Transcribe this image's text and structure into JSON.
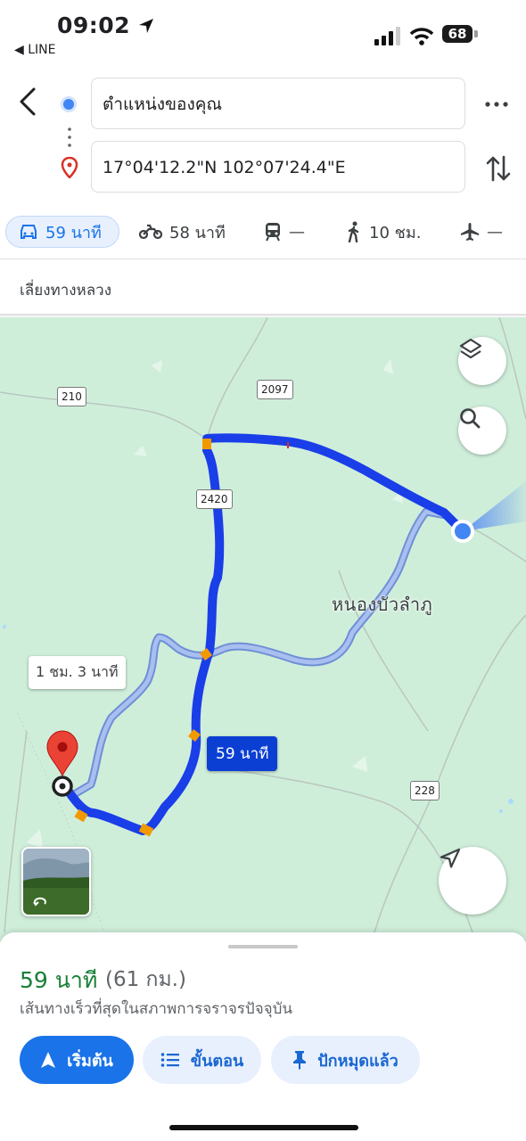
{
  "status_bar": {
    "time": "09:02",
    "back_app": "◀ LINE",
    "battery": "68"
  },
  "header": {
    "origin": "ตำแหน่งของคุณ",
    "destination": "17°04'12.2\"N 102°07'24.4\"E"
  },
  "modes": [
    {
      "name": "car",
      "label": "59 นาที",
      "active": true
    },
    {
      "name": "motorcycle",
      "label": "58 นาที",
      "active": false
    },
    {
      "name": "transit",
      "label": "—",
      "active": false
    },
    {
      "name": "walk",
      "label": "10 ชม.",
      "active": false
    },
    {
      "name": "flight",
      "label": "—",
      "active": false
    }
  ],
  "avoid_label": "เลี่ยงทางหลวง",
  "map": {
    "town_label": "หนองบัวลำภู",
    "road_shields": [
      "210",
      "2097",
      "2420",
      "228"
    ],
    "alt_route_callout": "1 ชม. 3 นาที",
    "main_route_callout": "59 นาที",
    "route_color": "#1a3ee8",
    "alt_route_color": "#a8bff0",
    "map_bg_color": "#cfeeda",
    "destination_pin_color": "#ea4335"
  },
  "sheet": {
    "duration": "59 นาที",
    "distance": "(61 กม.)",
    "description": "เส้นทางเร็วที่สุดในสภาพการจราจรปัจจุบัน",
    "start_label": "เริ่มต้น",
    "steps_label": "ขั้นตอน",
    "pinned_label": "ปักหมุดแล้ว"
  }
}
